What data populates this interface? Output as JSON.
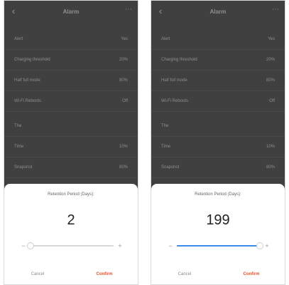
{
  "screens": [
    {
      "navbar": {
        "back_icon": "chevron-left-icon",
        "title": "Alarm",
        "more_icon": "more-icon"
      },
      "rows": [
        {
          "label": "Alert",
          "value": "Yes"
        },
        {
          "label": "Charging threshold",
          "value": "20%"
        },
        {
          "label": "Half full mode",
          "value": "80%"
        },
        {
          "label": "Wi-Fi Reboots",
          "value": "Off"
        },
        {
          "label_prefix": "The",
          "label_warn": "",
          "value": ""
        },
        {
          "label": "Time",
          "value": "10%"
        },
        {
          "label": "Snapshot",
          "value": "80%"
        }
      ],
      "sheet": {
        "title": "Retention Period (Days):",
        "value": "2",
        "slider_fraction": 0.01,
        "minus_icon": "minus-icon",
        "plus_icon": "plus-icon",
        "cancel_label": "Cancel",
        "confirm_label": "Confirm"
      }
    },
    {
      "navbar": {
        "back_icon": "chevron-left-icon",
        "title": "Alarm",
        "more_icon": "more-icon"
      },
      "rows": [
        {
          "label": "Alert",
          "value": "Yes"
        },
        {
          "label": "Charging threshold",
          "value": "20%"
        },
        {
          "label": "Half full mode",
          "value": "80%"
        },
        {
          "label": "Wi-Fi Reboots",
          "value": "Off"
        },
        {
          "label_prefix": "The",
          "label_warn": "",
          "value": ""
        },
        {
          "label": "Time",
          "value": "10%"
        },
        {
          "label": "Snapshot",
          "value": "80%"
        }
      ],
      "sheet": {
        "title": "Retention Period (Days):",
        "value": "199",
        "slider_fraction": 0.99,
        "minus_icon": "minus-icon",
        "plus_icon": "plus-icon",
        "cancel_label": "Cancel",
        "confirm_label": "Confirm"
      }
    }
  ],
  "colors": {
    "accent": "#3b8ee8",
    "confirm": "#e8502a",
    "overlay": "#404040"
  }
}
